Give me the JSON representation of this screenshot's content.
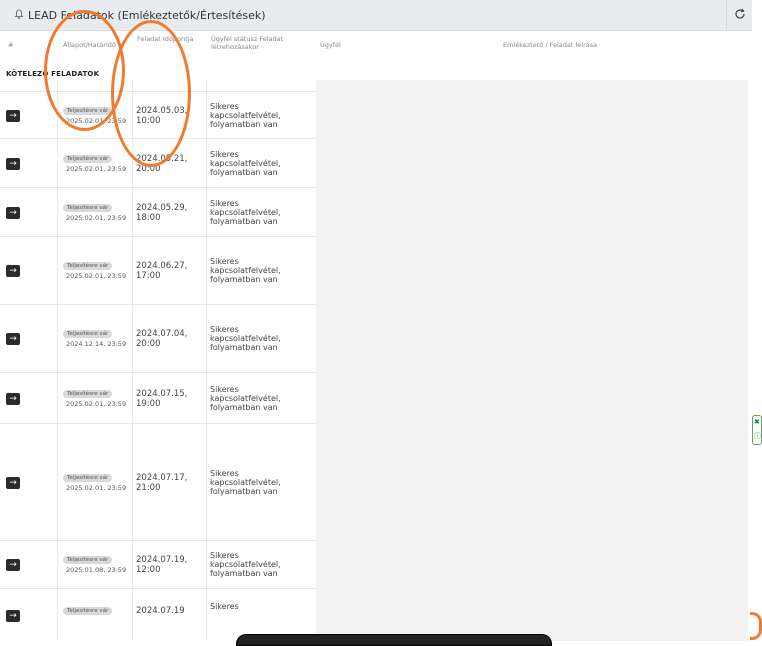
{
  "header": {
    "title": "LEAD Feladatok (Emlékeztetők/Értesítések)",
    "icons": {
      "bell": "bell-icon",
      "refresh": "refresh-icon"
    },
    "columns": [
      "#",
      "Állapot/Határidő",
      "Feladat Időpontja",
      "Ügyfél státusz Feladat létrehozásakor",
      "Ügyfél",
      "Emlékeztető / Feladat leírása"
    ]
  },
  "section_title": "KÖTELEZŐ FELADATOK",
  "rows": [
    {
      "badge": "Teljesítésre vár",
      "deadline": "2025.02.01, 23:59",
      "date": "2024.05.03, 10:00",
      "status": "Sikeres kapcsolatfelvétel, folyamatban van"
    },
    {
      "badge": "Teljesítésre vár",
      "deadline": "2025.02.01, 23:59",
      "date": "2024.05.21, 20:00",
      "status": "Sikeres kapcsolatfelvétel, folyamatban van"
    },
    {
      "badge": "Teljesítésre vár",
      "deadline": "2025.02.01, 23:59",
      "date": "2024.05.29, 18:00",
      "status": "Sikeres kapcsolatfelvétel, folyamatban van"
    },
    {
      "badge": "Teljesítésre vár",
      "deadline": "2025.02.01, 23:59",
      "date": "2024.06.27, 17:00",
      "status": "Sikeres kapcsolatfelvétel, folyamatban van"
    },
    {
      "badge": "Teljesítésre vár",
      "deadline": "2024.12.14, 23:59",
      "date": "2024.07.04, 20:00",
      "status": "Sikeres kapcsolatfelvétel, folyamatban van"
    },
    {
      "badge": "Teljesítésre vár",
      "deadline": "2025.02.01, 23:59",
      "date": "2024.07.15, 19:00",
      "status": "Sikeres kapcsolatfelvétel, folyamatban van"
    },
    {
      "badge": "Teljesítésre vár",
      "deadline": "2025.02.01, 23:59",
      "date": "2024.07.17, 21:00",
      "status": "Sikeres kapcsolatfelvétel, folyamatban van"
    },
    {
      "badge": "Teljesítésre vár",
      "deadline": "2025.01.08, 23:59",
      "date": "2024.07.19, 12:00",
      "status": "Sikeres kapcsolatfelvétel, folyamatban van"
    },
    {
      "badge": "Teljesítésre vár",
      "deadline": "",
      "date": "2024.07.19",
      "status": "Sikeres"
    }
  ],
  "colors": {
    "accent": "#f07a2e",
    "dark": "#2b2b2b",
    "header_bg": "#e9ebee",
    "panel_bg": "#f2f2f2"
  }
}
